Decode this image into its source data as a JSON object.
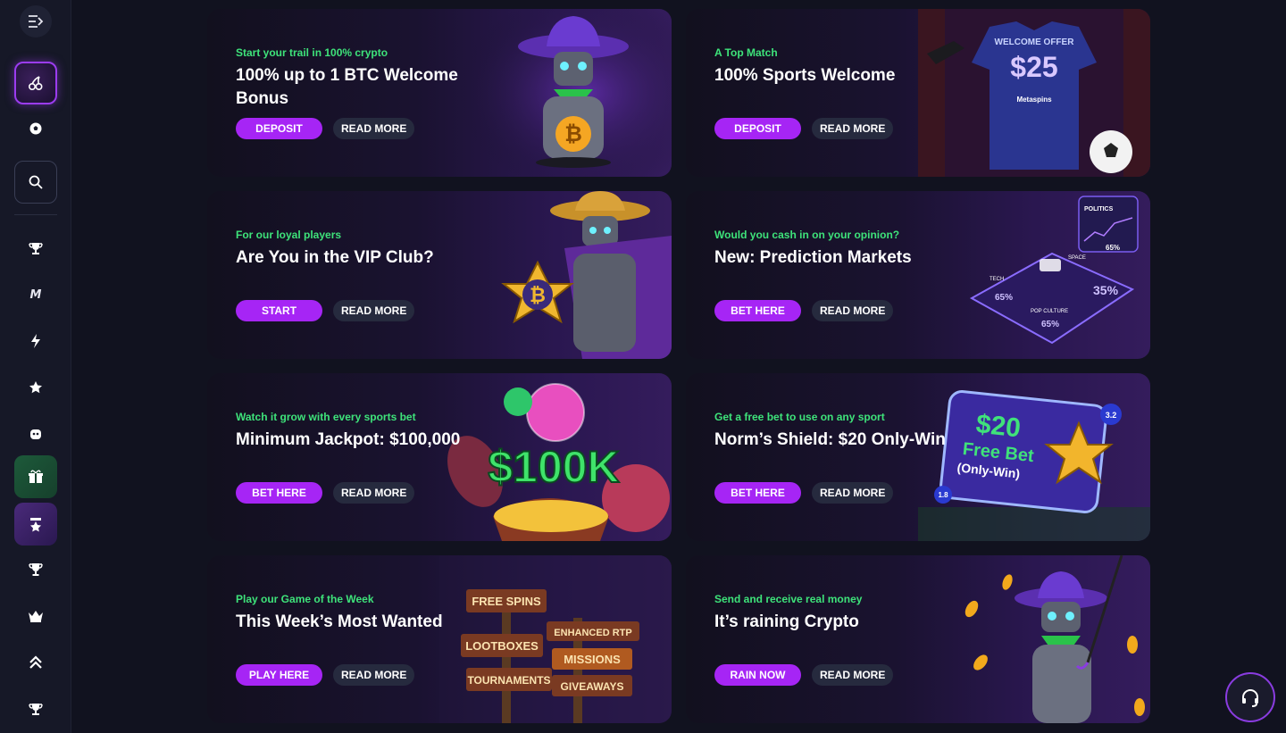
{
  "sidebar": {
    "items": [
      {
        "name": "collapse-icon",
        "glyph": "⇥"
      },
      {
        "name": "casino-icon",
        "glyph": "🍒"
      },
      {
        "name": "sports-ball-icon",
        "glyph": "⚽"
      },
      {
        "name": "search-icon",
        "glyph": "⌕"
      },
      {
        "name": "trophy-icon",
        "glyph": "🏆"
      },
      {
        "name": "metaspins-logo-icon",
        "glyph": "M"
      },
      {
        "name": "bolt-icon",
        "glyph": "⚡"
      },
      {
        "name": "star-icon",
        "glyph": "★"
      },
      {
        "name": "robot-icon",
        "glyph": "◉"
      },
      {
        "name": "gift-icon",
        "glyph": "🎁"
      },
      {
        "name": "badge-icon",
        "glyph": "✪"
      },
      {
        "name": "cup-icon",
        "glyph": "🏆"
      },
      {
        "name": "crown-icon",
        "glyph": "♛"
      },
      {
        "name": "chevrons-up-icon",
        "glyph": "⌃"
      },
      {
        "name": "trophy-icon-2",
        "glyph": "🏆"
      }
    ]
  },
  "promos": [
    {
      "eyebrow": "Start your trail in 100% crypto",
      "title": "100% up to 1 BTC Welcome Bonus",
      "primary": "DEPOSIT",
      "secondary": "READ MORE"
    },
    {
      "eyebrow": "A Top Match",
      "title": "100% Sports Welcome",
      "primary": "DEPOSIT",
      "secondary": "READ MORE"
    },
    {
      "eyebrow": "For our loyal players",
      "title": "Are You in the VIP Club?",
      "primary": "START",
      "secondary": "READ MORE"
    },
    {
      "eyebrow": "Would you cash in on your opinion?",
      "title": "New: Prediction Markets",
      "primary": "BET HERE",
      "secondary": "READ MORE"
    },
    {
      "eyebrow": "Watch it grow with every sports bet",
      "title": "Minimum Jackpot: $100,000",
      "primary": "BET HERE",
      "secondary": "READ MORE"
    },
    {
      "eyebrow": "Get a free bet to use on any sport",
      "title": "Norm’s Shield: $20 Only-Win",
      "primary": "BET HERE",
      "secondary": "READ MORE"
    },
    {
      "eyebrow": "Play our Game of the Week",
      "title": "This Week’s Most Wanted",
      "primary": "PLAY HERE",
      "secondary": "READ MORE"
    },
    {
      "eyebrow": "Send and receive real money",
      "title": "It’s raining Crypto",
      "primary": "RAIN NOW",
      "secondary": "READ MORE"
    }
  ],
  "art": {
    "welcome_offer": "WELCOME OFFER",
    "offer_amount": "$25",
    "brand": "Metaspins",
    "jackpot": "$100K",
    "free_bet_amount": "$20",
    "free_bet": "Free Bet",
    "only_win": "(Only-Win)",
    "odds_a": "3.2",
    "odds_b": "1.8",
    "politics": "POLITICS",
    "tech": "TECH",
    "space": "SPACE",
    "pop_culture": "POP CULTURE",
    "pct_65": "65%",
    "pct_35": "35%",
    "signs": [
      "FREE SPINS",
      "ENHANCED RTP",
      "LOOTBOXES",
      "MISSIONS",
      "TOURNAMENTS",
      "GIVEAWAYS"
    ]
  },
  "colors": {
    "accent_purple": "#a625f5",
    "eyebrow_green": "#3ee37a",
    "secondary_btn": "#262a3e",
    "page_bg": "#11121f"
  },
  "support": {
    "icon": "headset-icon"
  }
}
